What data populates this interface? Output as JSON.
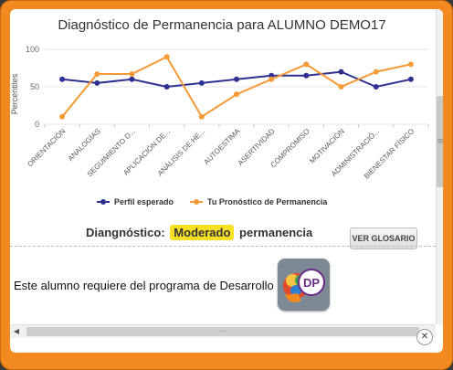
{
  "chart_data": {
    "type": "line",
    "title": "Diagnóstico de Permanencia para ALUMNO DEMO17",
    "xlabel": "",
    "ylabel": "Percentiles",
    "ylim": [
      0,
      100
    ],
    "yticks": [
      0,
      50,
      100
    ],
    "grid": true,
    "legend_position": "bottom",
    "categories": [
      "ORIENTACIÓN",
      "ANALOGÍAS",
      "SEGUIMIENTO D...",
      "APLICACIÓN DE...",
      "ANÁLISIS DE HE...",
      "AUTOESTIMA",
      "ASERTIVIDAD",
      "COMPROMISO",
      "MOTIVACIÓN",
      "ADMINISTRACIÓ...",
      "BIENESTAR FÍSICO"
    ],
    "series": [
      {
        "name": "Perfil esperado",
        "color": "#2e3192",
        "values": [
          60,
          55,
          60,
          50,
          55,
          60,
          65,
          65,
          70,
          50,
          60
        ]
      },
      {
        "name": "Tu Pronóstico de Permanencia",
        "color": "#f59a37",
        "values": [
          10,
          67,
          67,
          90,
          10,
          40,
          60,
          80,
          50,
          70,
          80
        ]
      }
    ]
  },
  "diagnosis": {
    "label": "Diangnóstico:",
    "level": "Moderado",
    "suffix": "permanencia",
    "level_color": "#f7e024"
  },
  "buttons": {
    "glossary": "VER GLOSARIO"
  },
  "message": "Este alumno requiere del programa de Desarrollo Personal",
  "logo": {
    "text": "DP"
  },
  "icons": {
    "close": "close-icon",
    "scroll_left": "arrow-left-icon",
    "scroll_right": "arrow-right-icon"
  }
}
